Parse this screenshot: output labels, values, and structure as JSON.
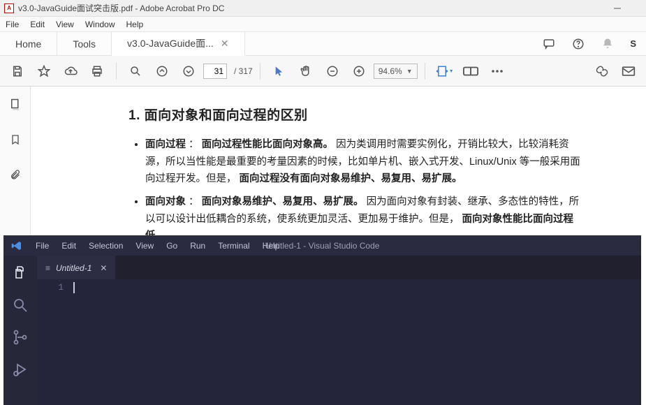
{
  "acrobat": {
    "titlebar": {
      "text": "v3.0-JavaGuide面试突击版.pdf - Adobe Acrobat Pro DC"
    },
    "menubar": [
      "File",
      "Edit",
      "View",
      "Window",
      "Help"
    ],
    "tabs": {
      "home": "Home",
      "tools": "Tools",
      "doc": "v3.0-JavaGuide面..."
    },
    "signin": "S",
    "toolbar": {
      "page_current": "31",
      "page_total": "/ 317",
      "zoom": "94.6%"
    },
    "content": {
      "heading": "1. 面向对象和面向过程的区别",
      "items": [
        {
          "label": "面向过程",
          "sep": "：",
          "bold1": "面向过程性能比面向对象高。",
          "text": "因为类调用时需要实例化，开销比较大，比较消耗资源，所以当性能是最重要的考量因素的时候，比如单片机、嵌入式开发、Linux/Unix 等一般采用面向过程开发。但是，",
          "bold2": "面向过程没有面向对象易维护、易复用、易扩展。"
        },
        {
          "label": "面向对象",
          "sep": "：",
          "bold1": "面向对象易维护、易复用、易扩展。",
          "text": "因为面向对象有封装、继承、多态性的特性，所以可以设计出低耦合的系统，使系统更加灵活、更加易于维护。但是，",
          "bold2": "面向对象性能比面向过程低。"
        }
      ]
    },
    "side_icons": [
      "thumbnails-icon",
      "bookmark-icon",
      "attachment-icon"
    ]
  },
  "vscode": {
    "menubar": [
      "File",
      "Edit",
      "Selection",
      "View",
      "Go",
      "Run",
      "Terminal",
      "Help"
    ],
    "title": "Untitled-1 - Visual Studio Code",
    "tab": "Untitled-1",
    "line": "1"
  }
}
